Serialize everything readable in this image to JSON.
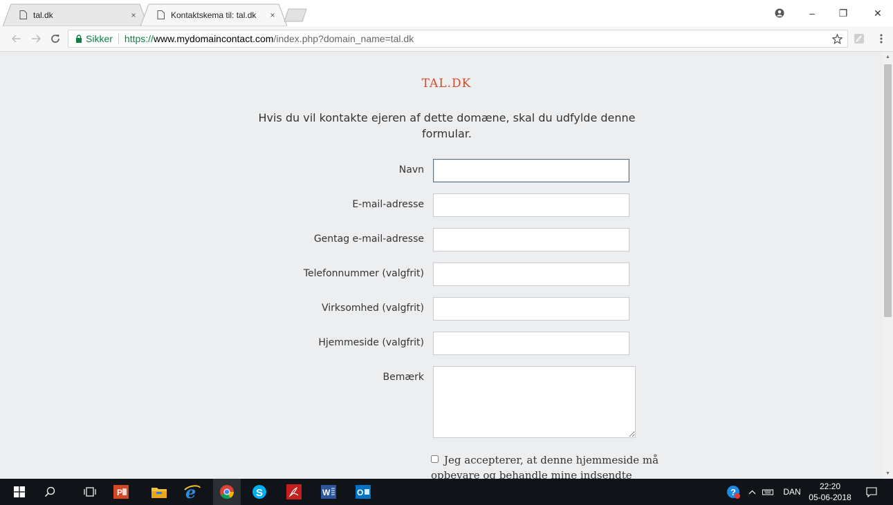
{
  "browser": {
    "tabs": [
      {
        "label": "tal.dk",
        "active": false
      },
      {
        "label": "Kontaktskema til: tal.dk",
        "active": true
      }
    ],
    "tab_close": "×",
    "window_controls": {
      "minimize": "–",
      "restore": "❐",
      "close": "✕"
    },
    "security_label": "Sikker",
    "url_scheme": "https://",
    "url_host": "www.mydomaincontact.com",
    "url_path": "/index.php?domain_name=tal.dk"
  },
  "page": {
    "site_title": "TAL.DK",
    "intro": "Hvis du vil kontakte ejeren af dette domæne, skal du udfylde denne formular.",
    "fields": [
      {
        "label": "Navn",
        "value": ""
      },
      {
        "label": "E-mail-adresse",
        "value": ""
      },
      {
        "label": "Gentag e-mail-adresse",
        "value": ""
      },
      {
        "label": "Telefonnummer (valgfrit)",
        "value": ""
      },
      {
        "label": "Virksomhed (valgfrit)",
        "value": ""
      },
      {
        "label": "Hjemmeside (valgfrit)",
        "value": ""
      }
    ],
    "remark_label": "Bemærk",
    "consent_text": "Jeg accepterer, at denne hjemmeside må opbevare og behandle mine indsendte"
  },
  "taskbar": {
    "language": "DAN",
    "time": "22:20",
    "date": "05-06-2018"
  },
  "colors": {
    "accent": "#d34a2a",
    "page_bg": "#eceef0",
    "secure_green": "#0b8043",
    "taskbar_bg": "#101418"
  }
}
